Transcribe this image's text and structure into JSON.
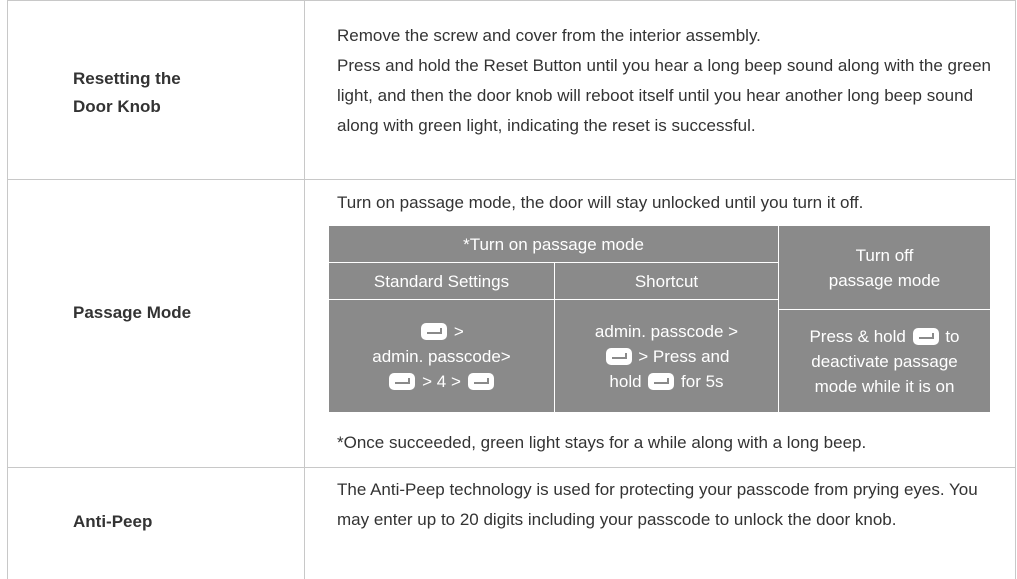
{
  "rows": [
    {
      "label": "Resetting the Door Knob",
      "label_lines": [
        "Resetting the",
        "Door Knob"
      ],
      "paragraphs": [
        "Remove the screw and cover from the interior assembly.",
        "Press and hold the Reset Button until you hear a long beep sound along with the green light, and then the door knob will reboot itself until you hear another long beep sound along with green light, indicating the reset is successful."
      ]
    },
    {
      "label": "Passage Mode",
      "intro": "Turn on passage mode, the door will stay unlocked until you turn it off.",
      "table": {
        "header_on": "*Turn on passage mode",
        "header_off_line1": "Turn off",
        "header_off_line2": "passage mode",
        "col_standard": "Standard Settings",
        "col_shortcut": "Shortcut",
        "standard_steps": {
          "line1_suffix": ">",
          "line2": "admin. passcode>",
          "line3_mid": "> 4 >"
        },
        "shortcut_steps": {
          "line1": "admin. passcode >",
          "line2_suffix": "> Press and",
          "line3_prefix": "hold",
          "line3_suffix": "for 5s"
        },
        "off_steps": {
          "line1_prefix": "Press & hold",
          "line1_suffix": "to",
          "line2": "deactivate passage",
          "line3": "mode while it is on"
        }
      },
      "note": "*Once succeeded, green light stays for a while along with a long beep."
    },
    {
      "label": "Anti-Peep",
      "description": "The Anti-Peep technology is used for protecting your passcode from prying eyes. You may enter up to 20 digits including your passcode to unlock the door knob."
    }
  ],
  "icons": {
    "enter_key": "enter-key-icon"
  },
  "colors": {
    "table_fill": "#8a8a8a",
    "text": "#333333",
    "rule": "#c8c8c8"
  }
}
